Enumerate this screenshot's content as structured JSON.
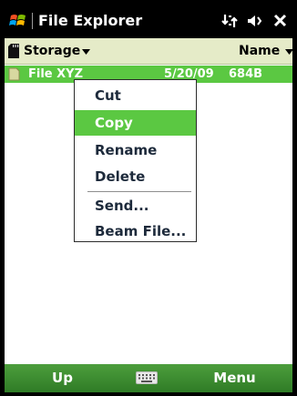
{
  "titlebar": {
    "title": "File Explorer"
  },
  "listbar": {
    "folder": "Storage",
    "sort": "Name"
  },
  "file": {
    "name": "File XYZ",
    "date": "5/20/09",
    "size": "684B"
  },
  "context_menu": {
    "items": [
      "Cut",
      "Copy",
      "Rename",
      "Delete",
      "Send...",
      "Beam File..."
    ],
    "selected": "Copy"
  },
  "softkeys": {
    "left": "Up",
    "right": "Menu"
  },
  "colors": {
    "accent": "#5bc842",
    "header_bg": "#e5ebc8",
    "softbar": "#3a8c30"
  },
  "icons": [
    "windows-start-icon",
    "connectivity-icon",
    "volume-icon",
    "close-icon",
    "storage-card-icon",
    "file-icon",
    "keyboard-icon"
  ]
}
